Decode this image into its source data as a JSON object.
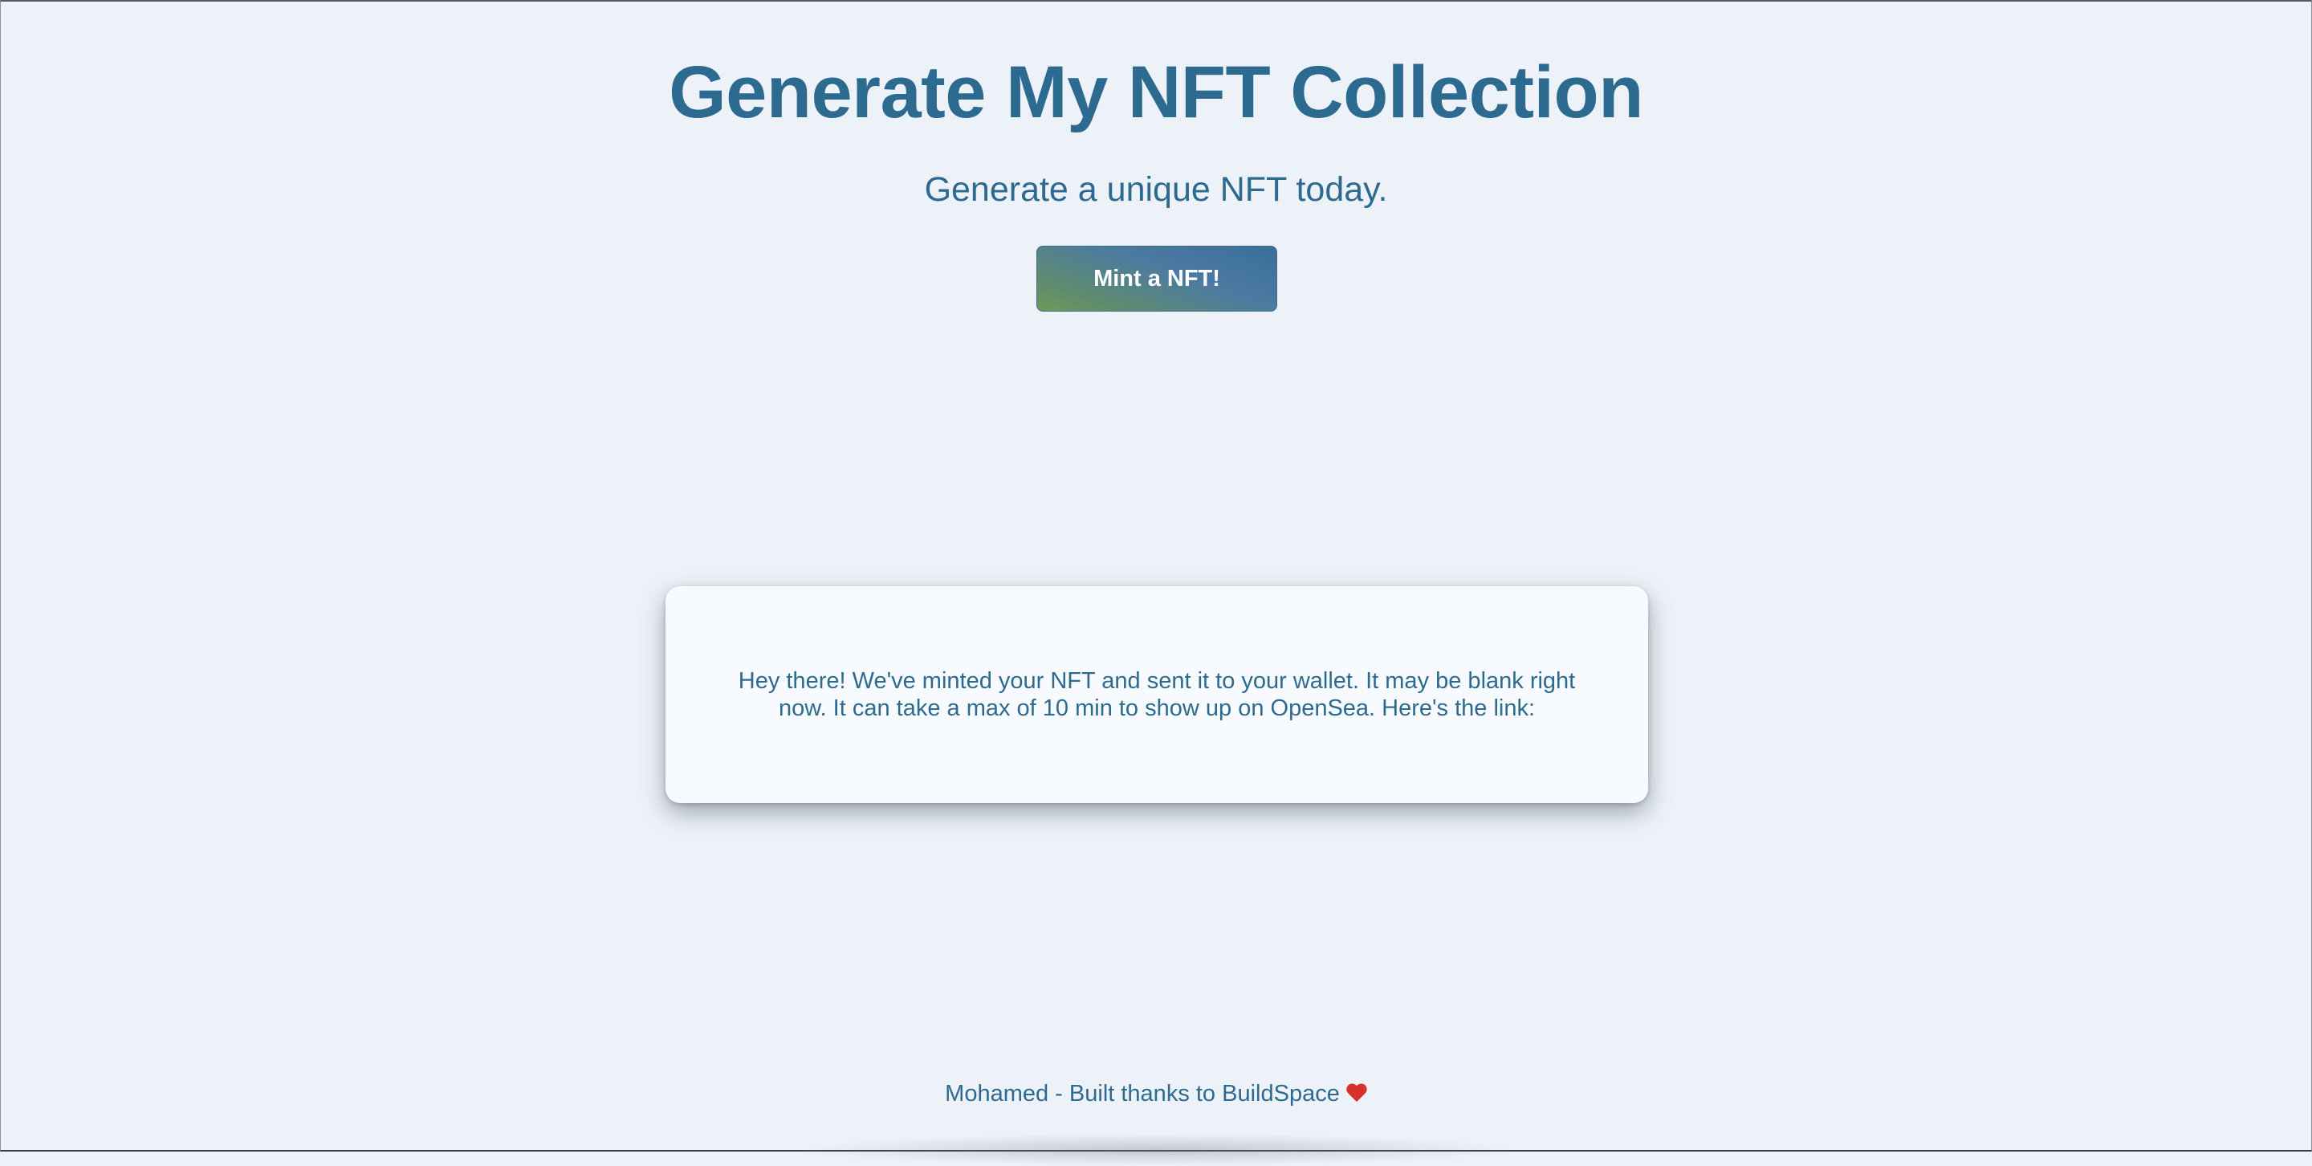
{
  "header": {
    "title": "Generate My NFT Collection",
    "subtitle": "Generate a unique NFT today."
  },
  "actions": {
    "mint_label": "Mint a NFT!"
  },
  "message_card": {
    "text": "Hey there! We've minted your NFT and sent it to your wallet. It may be blank right now. It can take a max of 10 min to show up on OpenSea. Here's the link:"
  },
  "footer": {
    "text": "Mohamed - Built thanks to BuildSpace",
    "icon": "heart-icon"
  },
  "colors": {
    "background": "#edf2f9",
    "text": "#2d6a8f",
    "card": "#f7fbff",
    "heart": "#d9302c"
  }
}
